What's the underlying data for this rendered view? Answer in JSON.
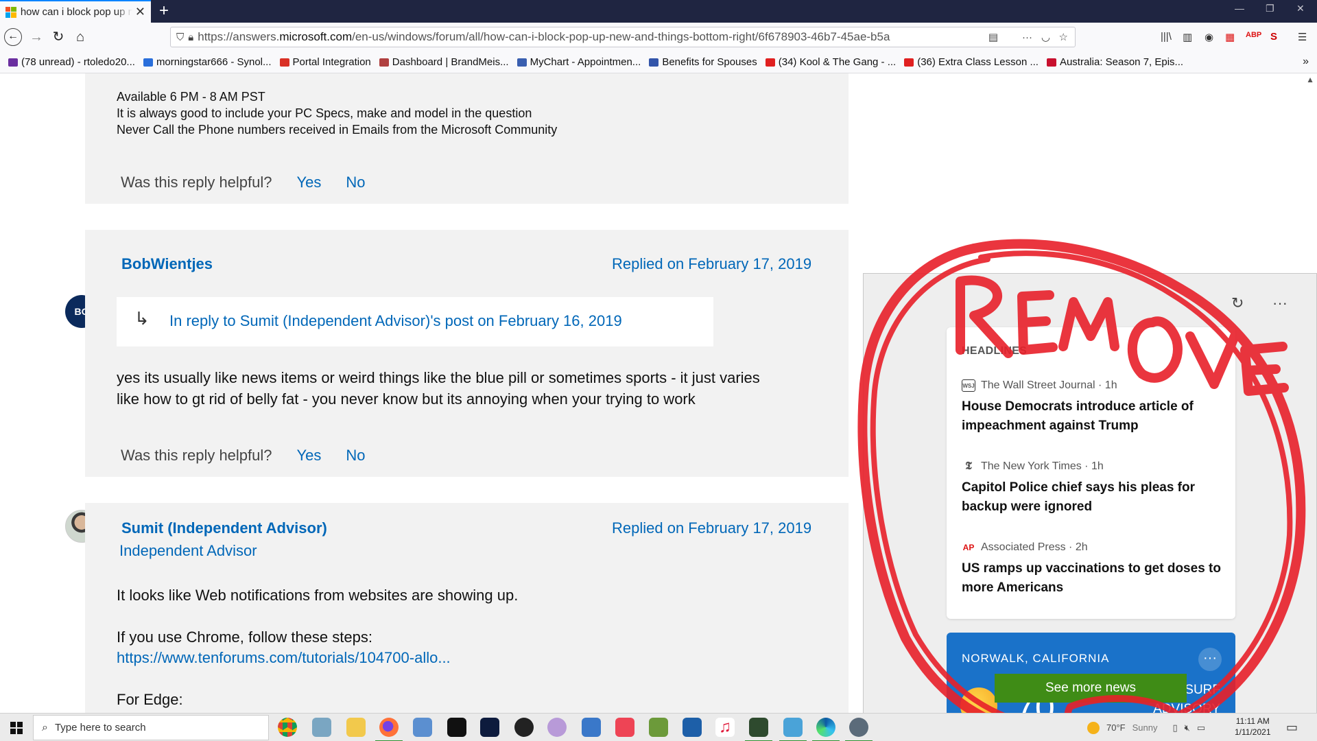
{
  "browser": {
    "tab_title": "how can i block pop up new and things bottom right",
    "tab_close": "✕",
    "new_tab": "+",
    "url_prefix": "https://answers.",
    "url_domain": "microsoft.com",
    "url_rest": "/en-us/windows/forum/all/how-can-i-block-pop-up-new-and-things-bottom-right/6f678903-46b7-45ae-b5a",
    "bookmarks": [
      {
        "label": "(78 unread) - rtoledo20...",
        "color": "#6b2fa0"
      },
      {
        "label": "morningstar666 - Synol...",
        "color": "#2a6fdb"
      },
      {
        "label": "Portal Integration",
        "color": "#d93025"
      },
      {
        "label": "Dashboard | BrandMeis...",
        "color": "#b04040"
      },
      {
        "label": "MyChart - Appointmen...",
        "color": "#3a5fb0"
      },
      {
        "label": "Benefits for Spouses",
        "color": "#3355aa"
      },
      {
        "label": "(34) Kool & The Gang - ...",
        "color": "#e02020"
      },
      {
        "label": "(36) Extra Class Lesson ...",
        "color": "#e02020"
      },
      {
        "label": "Australia: Season 7, Epis...",
        "color": "#c8102e"
      }
    ],
    "bookmarks_more": "»"
  },
  "posts": {
    "top": {
      "lines": [
        "Available 6 PM - 8 AM PST",
        "It is always good to include your PC Specs, make and model in the question",
        "Never Call the Phone numbers received in Emails from the Microsoft Community"
      ],
      "helpful": "Was this reply helpful?",
      "yes": "Yes",
      "no": "No"
    },
    "bob": {
      "initials": "BO",
      "name": "BobWientjes",
      "date": "Replied on February 17, 2019",
      "reply_arrow": "↳",
      "reply_to": "In reply to Sumit (Independent Advisor)'s post on February 16, 2019",
      "line1": "yes its usually like news items or weird things like the blue pill or sometimes sports - it just varies",
      "line2": "like how to gt rid of belly fat - you never know but its annoying when your trying to work",
      "helpful": "Was this reply helpful?",
      "yes": "Yes",
      "no": "No"
    },
    "sumit": {
      "name": "Sumit (Independent Advisor)",
      "role": "Independent Advisor",
      "date": "Replied on February 17, 2019",
      "line1": "It looks like Web notifications from websites are showing up.",
      "line2": "If you use Chrome, follow these steps:",
      "link": "https://www.tenforums.com/tutorials/104700-allo...",
      "line3": "For Edge:"
    }
  },
  "news": {
    "header": "HEADLINES",
    "stories": [
      {
        "logo": "WSJ",
        "source": "The Wall Street Journal · 1h",
        "headline": "House Democrats introduce article of impeachment against Trump"
      },
      {
        "logo": "𝕿",
        "source": "The New York Times · 1h",
        "headline": "Capitol Police chief says his pleas for backup were ignored"
      },
      {
        "logo": "AP",
        "source": "Associated Press · 2h",
        "headline": "US ramps up vaccinations to get doses to more Americans"
      }
    ],
    "weather_location": "NORWALK, CALIFORNIA",
    "weather_temp_partial": "70",
    "advisory_line1": "SURF",
    "advisory_line2": "ADVISORY",
    "see_more": "See more news",
    "refresh": "↻",
    "menu": "···",
    "weather_menu": "···"
  },
  "annotation": {
    "text": "REMOVE",
    "color": "#e8202a"
  },
  "taskbar": {
    "search_placeholder": "Type here to search",
    "weather_temp": "70°F",
    "weather_cond": "Sunny",
    "time": "11:11 AM",
    "date": "1/11/2021"
  }
}
